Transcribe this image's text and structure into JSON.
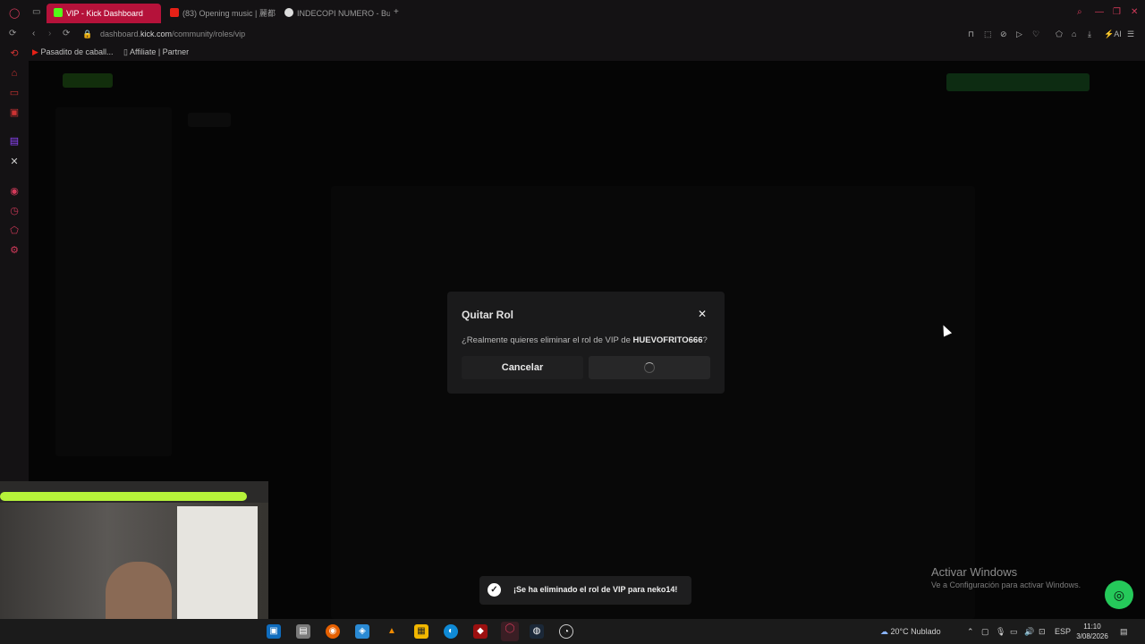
{
  "browser": {
    "tabs": [
      {
        "label": "VIP - Kick Dashboard",
        "active": true,
        "favicon": "kick-icon"
      },
      {
        "label": "(83) Opening music | 麗都",
        "active": false,
        "favicon": "youtube-icon"
      },
      {
        "label": "INDECOPI NUMERO - Busc",
        "active": false,
        "favicon": "google-icon"
      }
    ],
    "address": {
      "prefix": "dashboard.",
      "domain": "kick.com",
      "path": "/community/roles/vip"
    },
    "bookmarks": [
      {
        "label": "Pasadito de caball...",
        "icon": "youtube-icon"
      },
      {
        "label": "Affiliate | Partner",
        "icon": "page-icon"
      }
    ],
    "ai_label": "AI"
  },
  "modal": {
    "title": "Quitar Rol",
    "message_prefix": "¿Realmente quieres eliminar el rol de VIP de ",
    "username": "HUEVOFRITO666",
    "message_suffix": "?",
    "cancel_label": "Cancelar",
    "close_icon": "close-icon"
  },
  "toast": {
    "text": "¡Se ha eliminado el rol de VIP para neko14!",
    "icon": "check-circle-icon"
  },
  "watermark": {
    "line1": "Activar Windows",
    "line2": "Ve a Configuración para activar Windows."
  },
  "taskbar": {
    "weather": "20°C  Nublado",
    "lang": "ESP",
    "time": "11:10",
    "date": "3/08/2026"
  },
  "colors": {
    "accent": "#b5123a",
    "kick_green": "#53fc18",
    "toast_bg": "#1e1e1f"
  }
}
